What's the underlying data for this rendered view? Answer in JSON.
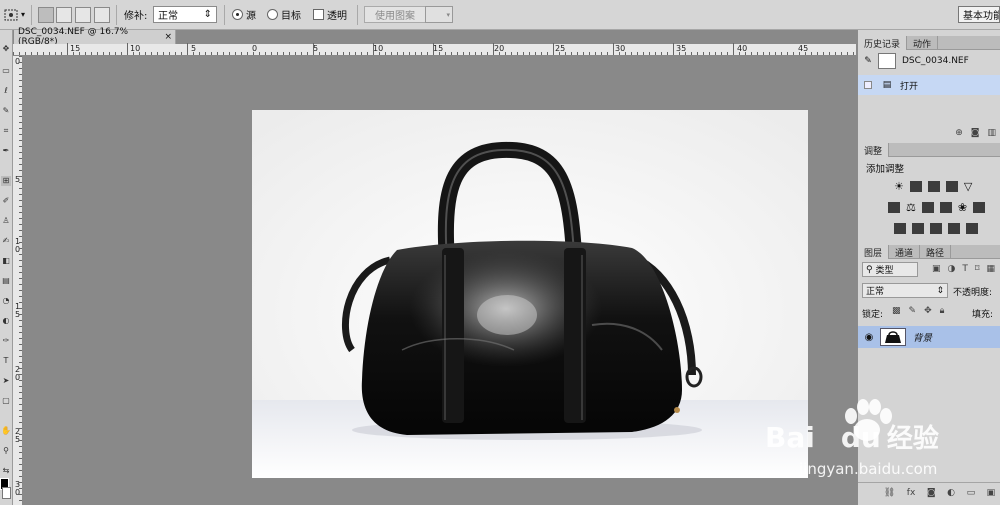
{
  "options_bar": {
    "repair_label": "修补:",
    "mode_value": "正常",
    "source_label": "源",
    "target_label": "目标",
    "transparent_label": "透明",
    "use_pattern_label": "使用图案",
    "workspace_label": "基本功能"
  },
  "document": {
    "tab_title": "DSC_0034.NEF @ 16.7%(RGB/8*)",
    "close_glyph": "×",
    "ruler_h_numbers": [
      "15",
      "10",
      "5",
      "0",
      "5",
      "10",
      "15",
      "20",
      "25",
      "30",
      "35",
      "40",
      "45"
    ],
    "ruler_v_numbers": [
      "0",
      "5",
      "1\n0",
      "1\n5",
      "2\n0",
      "2\n5",
      "3\n0"
    ]
  },
  "history_panel": {
    "tabs": [
      "历史记录",
      "动作"
    ],
    "snapshot_name": "DSC_0034.NEF",
    "step_name": "打开"
  },
  "adjustments_panel": {
    "tab": "调整",
    "add_label": "添加调整"
  },
  "layers_panel": {
    "tabs": [
      "图层",
      "通道",
      "路径"
    ],
    "filter_kind": "类型",
    "blend_mode": "正常",
    "opacity_label": "不透明度:",
    "lock_label": "锁定:",
    "fill_label": "填充:",
    "layer_name": "背景"
  },
  "watermark": {
    "brand_en": "Bai",
    "brand_du": "du",
    "brand_cn": "经验",
    "url": "jingyan.baidu.com"
  }
}
